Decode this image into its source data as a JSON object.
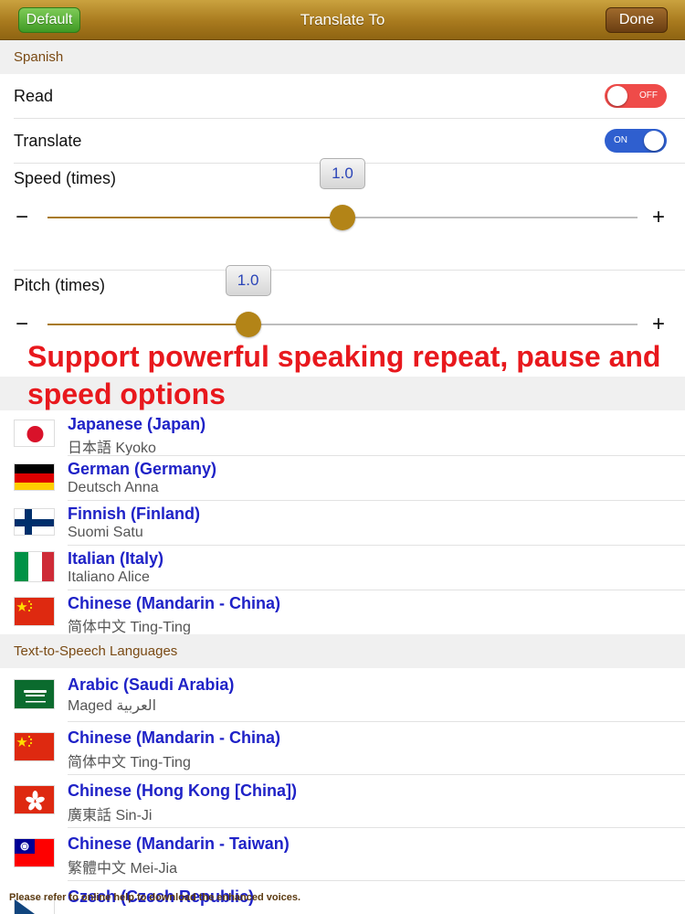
{
  "navbar": {
    "title": "Translate To",
    "default_label": "Default",
    "done_label": "Done"
  },
  "section_spanish": "Spanish",
  "read": {
    "label": "Read",
    "state": "OFF"
  },
  "translate": {
    "label": "Translate",
    "state": "ON"
  },
  "speed": {
    "label": "Speed (times)",
    "value": "1.0",
    "fraction": 0.5,
    "minus": "−",
    "plus": "+"
  },
  "pitch": {
    "label": "Pitch (times)",
    "value": "1.0",
    "fraction": 0.34,
    "minus": "−",
    "plus": "+"
  },
  "promo_text": "Support powerful speaking repeat, pause and speed options",
  "recent_languages": [
    {
      "name": "Japanese (Japan)",
      "voice": "日本語 Kyoko",
      "flag": "japan-flag-icon"
    },
    {
      "name": "German (Germany)",
      "voice": "Deutsch Anna",
      "flag": "germany-flag-icon"
    },
    {
      "name": "Finnish (Finland)",
      "voice": "Suomi Satu",
      "flag": "finland-flag-icon"
    },
    {
      "name": "Italian (Italy)",
      "voice": "Italiano Alice",
      "flag": "italy-flag-icon"
    },
    {
      "name": "Chinese (Mandarin - China)",
      "voice": "简体中文 Ting-Ting",
      "flag": "china-flag-icon"
    }
  ],
  "section_tts": "Text-to-Speech Languages",
  "tts_languages": [
    {
      "name": "Arabic (Saudi Arabia)",
      "voice": "Maged العربية",
      "flag": "saudi-arabia-flag-icon"
    },
    {
      "name": "Chinese (Mandarin - China)",
      "voice": "简体中文 Ting-Ting",
      "flag": "china-flag-icon"
    },
    {
      "name": "Chinese (Hong Kong [China])",
      "voice": "廣東話 Sin-Ji",
      "flag": "hong-kong-flag-icon"
    },
    {
      "name": "Chinese (Mandarin - Taiwan)",
      "voice": "繁體中文 Mei-Jia",
      "flag": "taiwan-flag-icon"
    },
    {
      "name": "Czech (Czech Republic)",
      "voice": "",
      "flag": "czech-flag-icon"
    }
  ],
  "footer_note": "Please refer to online help to download the enhanced voices.",
  "colors": {
    "accent_gold": "#a87a1e",
    "link_blue": "#1f22c7",
    "promo_red": "#e8181d"
  }
}
